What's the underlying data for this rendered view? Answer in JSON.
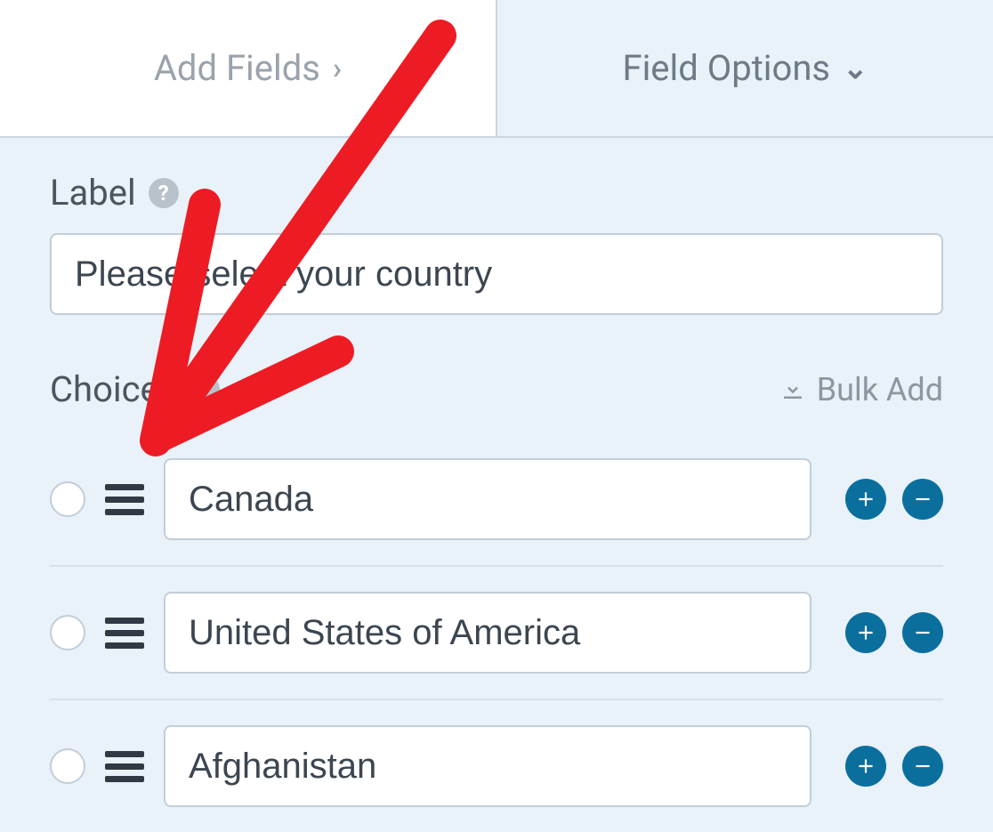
{
  "tabs": {
    "add_fields": "Add Fields",
    "field_options": "Field Options"
  },
  "label_section": {
    "title": "Label",
    "value": "Please select your country"
  },
  "choices_section": {
    "title": "Choices",
    "bulk_add": "Bulk Add",
    "items": [
      {
        "value": "Canada"
      },
      {
        "value": "United States of America"
      },
      {
        "value": "Afghanistan"
      }
    ]
  }
}
